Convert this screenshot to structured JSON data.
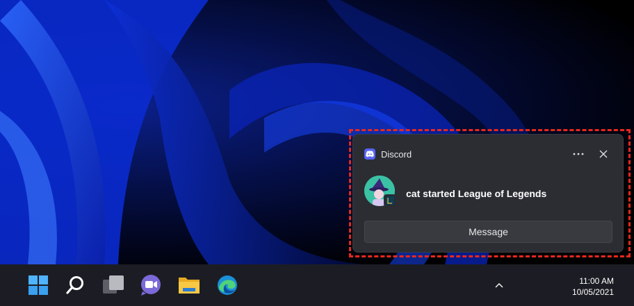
{
  "notification": {
    "app_name": "Discord",
    "app_icon": "discord-icon",
    "text": "cat started League of Legends",
    "action_label": "Message",
    "more_icon": "more-horizontal-icon",
    "close_icon": "close-icon",
    "accent_color": "#5865f2",
    "highlight_color": "#e8281e"
  },
  "taskbar": {
    "items": [
      {
        "icon": "start-windows-icon"
      },
      {
        "icon": "search-icon"
      },
      {
        "icon": "task-view-icon"
      },
      {
        "icon": "chat-icon"
      },
      {
        "icon": "file-explorer-icon"
      },
      {
        "icon": "edge-browser-icon"
      }
    ],
    "tray_icon": "chevron-up-icon",
    "time": "11:00 AM",
    "date": "10/05/2021"
  }
}
